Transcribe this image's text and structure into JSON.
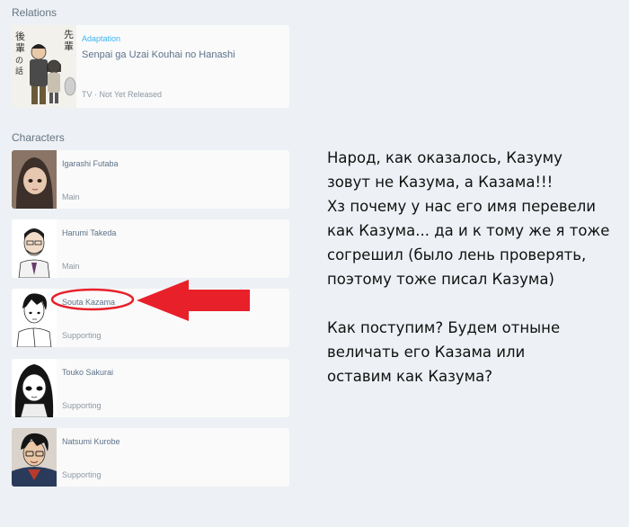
{
  "relations": {
    "title": "Relations",
    "item": {
      "relation": "Adaptation",
      "name": "Senpai ga Uzai Kouhai no Hanashi",
      "meta": "TV · Not Yet Released",
      "cover_text": "先輩がうざい後輩の話"
    }
  },
  "characters": {
    "title": "Characters",
    "items": [
      {
        "name": "Igarashi Futaba",
        "role": "Main"
      },
      {
        "name": "Harumi Takeda",
        "role": "Main"
      },
      {
        "name": "Souta Kazama",
        "role": "Supporting"
      },
      {
        "name": "Touko Sakurai",
        "role": "Supporting"
      },
      {
        "name": "Natsumi Kurobe",
        "role": "Supporting"
      }
    ]
  },
  "annotation": {
    "text": "Народ, как оказалось, Казуму\nзовут не Казума, а Казама!!!\nХз почему у нас его имя перевели\nкак Казума... да и к тому же я тоже\nсогрешил (было лень проверять,\nпоэтому тоже писал Казума)\n\nКак поступим? Будем отныне\nвеличать его Казама или\nоставим как Казума?",
    "highlight_color": "#e8202a"
  },
  "colors": {
    "accent": "#3db4f2",
    "page_bg": "#edf1f5",
    "card_bg": "#fafafa"
  }
}
